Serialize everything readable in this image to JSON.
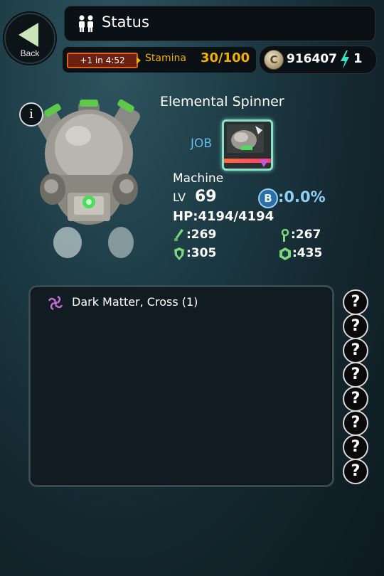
{
  "header": {
    "back_label": "Back",
    "title": "Status"
  },
  "stamina": {
    "timer": "+1 in 4:52",
    "label": "Stamina",
    "value": "30/100"
  },
  "currency": {
    "coin_symbol": "C",
    "coins": "916407",
    "energy": "1"
  },
  "character": {
    "info_label": "i",
    "name": "Elemental Spinner",
    "job_label": "JOB",
    "race": "Machine",
    "lv_label": "LV",
    "level": "69",
    "b_symbol": "B",
    "b_value": ":0.0%",
    "hp": "HP:4194/4194",
    "attack": ":269",
    "magic": ":267",
    "defense": ":305",
    "resistance": ":435"
  },
  "skills": [
    {
      "name": "Dark Matter, Cross (1)",
      "icon": "purple-swirl-icon"
    }
  ],
  "slots": [
    "?",
    "?",
    "?",
    "?",
    "?",
    "?",
    "?",
    "?"
  ],
  "colors": {
    "stamina": "#f0b000",
    "job": "#6cb8e8",
    "b_value": "#8fd0f6"
  }
}
